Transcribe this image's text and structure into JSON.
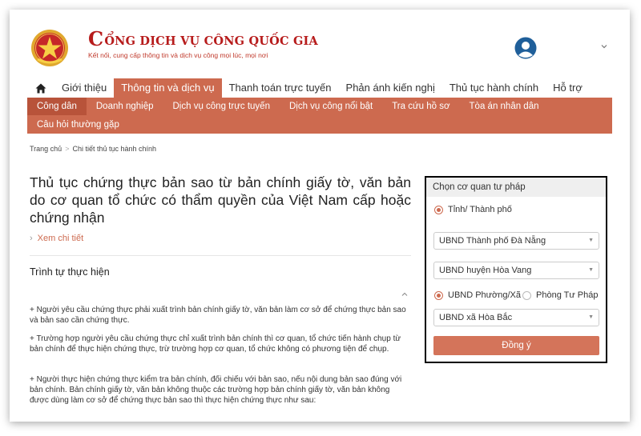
{
  "header": {
    "brand_title_first": "C",
    "brand_title_rest": "ỔNG DỊCH VỤ CÔNG QUỐC GIA",
    "brand_subtitle": "Kết nối, cung cấp thông tin và dịch vụ công mọi lúc, mọi nơi",
    "icons": [
      "national-emblem-icon",
      "user-avatar-icon",
      "chevron-down-icon"
    ]
  },
  "nav": {
    "home_icon": "home-icon",
    "items": [
      {
        "label": "Giới thiệu",
        "active": false
      },
      {
        "label": "Thông tin và dịch vụ",
        "active": true
      },
      {
        "label": "Thanh toán trực tuyến",
        "active": false
      },
      {
        "label": "Phản ánh kiến nghị",
        "active": false
      },
      {
        "label": "Thủ tục hành chính",
        "active": false
      },
      {
        "label": "Hỗ trợ",
        "active": false
      }
    ]
  },
  "subnav": {
    "items": [
      {
        "label": "Công dân",
        "active": true
      },
      {
        "label": "Doanh nghiệp",
        "active": false
      },
      {
        "label": "Dịch vụ công trực tuyến",
        "active": false
      },
      {
        "label": "Dịch vụ công nổi bật",
        "active": false
      },
      {
        "label": "Tra cứu hồ sơ",
        "active": false
      },
      {
        "label": "Tòa án nhân dân",
        "active": false
      },
      {
        "label": "Câu hỏi thường gặp",
        "active": false
      }
    ]
  },
  "breadcrumb": {
    "home": "Trang chủ",
    "separator": ">",
    "current": "Chi tiết thủ tục hành chính"
  },
  "main": {
    "title": "Thủ tục chứng thực bản sao từ bản chính giấy tờ, văn bản do cơ quan tổ chức có thẩm quyền của Việt Nam cấp hoặc chứng nhận",
    "see_more": "Xem chi tiết",
    "section_title": "Trình tự thực hiện",
    "paragraphs": [
      "+ Người yêu cầu chứng thực phải xuất trình bản chính giấy tờ, văn bản làm cơ sở để chứng thực bản sao và bản sao cần chứng thực.",
      "+ Trường hợp người yêu cầu chứng thực chỉ xuất trình bản chính thì cơ quan, tổ chức tiến hành chụp từ bản chính để thực hiện chứng thực, trừ trường hợp cơ quan, tổ chức không có phương tiện để chụp.",
      "+ Người thực hiện chứng thực kiểm tra bản chính, đối chiếu với bản sao, nếu nội dung bản sao đúng với bản chính. Bản chính giấy tờ, văn bản không thuộc các trường hợp bản chính giấy tờ, văn bản không được dùng làm cơ sở để chứng thực bản sao thì thực hiện chứng thực như sau:"
    ]
  },
  "panel": {
    "title": "Chọn cơ quan tư pháp",
    "radio_province": "Tỉnh/ Thành phố",
    "select_city": "UBND Thành phố Đà Nẵng",
    "select_district": "UBND huyện Hòa Vang",
    "radio_ward": "UBND Phường/Xã",
    "radio_justice": "Phòng Tư Pháp",
    "select_ward": "UBND xã Hòa Bắc",
    "submit": "Đồng ý"
  },
  "colors": {
    "accent": "#cd6a4f",
    "accent_dark": "#b8533a",
    "brand_red": "#b71c1c",
    "button": "#d4745a"
  }
}
